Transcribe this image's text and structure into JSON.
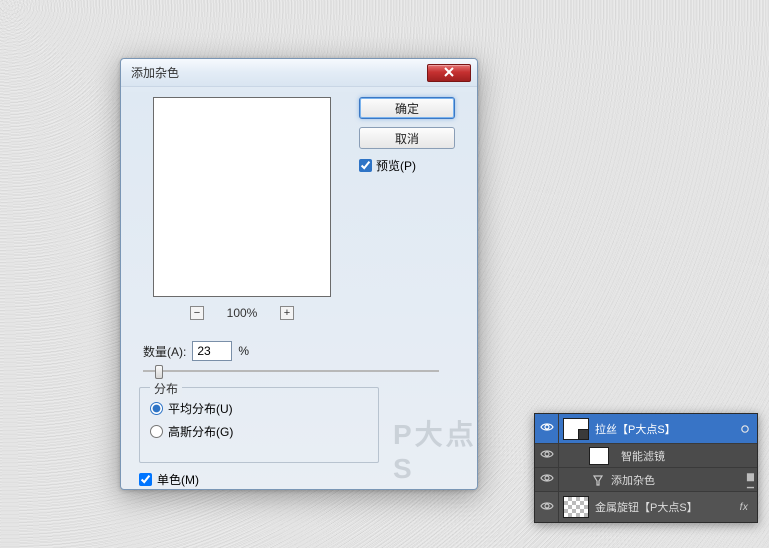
{
  "dialog": {
    "title": "添加杂色",
    "ok_label": "确定",
    "cancel_label": "取消",
    "preview_label": "预览(P)",
    "preview_checked": true,
    "zoom": {
      "value": "100%",
      "minus": "−",
      "plus": "+"
    },
    "amount": {
      "label": "数量(A):",
      "value": "23",
      "suffix": "%"
    },
    "dist": {
      "legend": "分布",
      "uniform_label": "平均分布(U)",
      "gaussian_label": "高斯分布(G)",
      "selected": "uniform"
    },
    "mono": {
      "label": "单色(M)",
      "checked": true
    },
    "watermark": "P大点S"
  },
  "layers": {
    "rows": [
      {
        "name": "拉丝【P大点S】",
        "visible": true,
        "selected": true,
        "has_smart": true
      },
      {
        "name": "智能滤镜",
        "visible": true,
        "sub": true,
        "kind": "filter-header"
      },
      {
        "name": "添加杂色",
        "visible": true,
        "sub": true,
        "kind": "filter-item"
      },
      {
        "name": "金属旋钮【P大点S】",
        "visible": true,
        "fx": "fx",
        "checker": true
      }
    ]
  }
}
